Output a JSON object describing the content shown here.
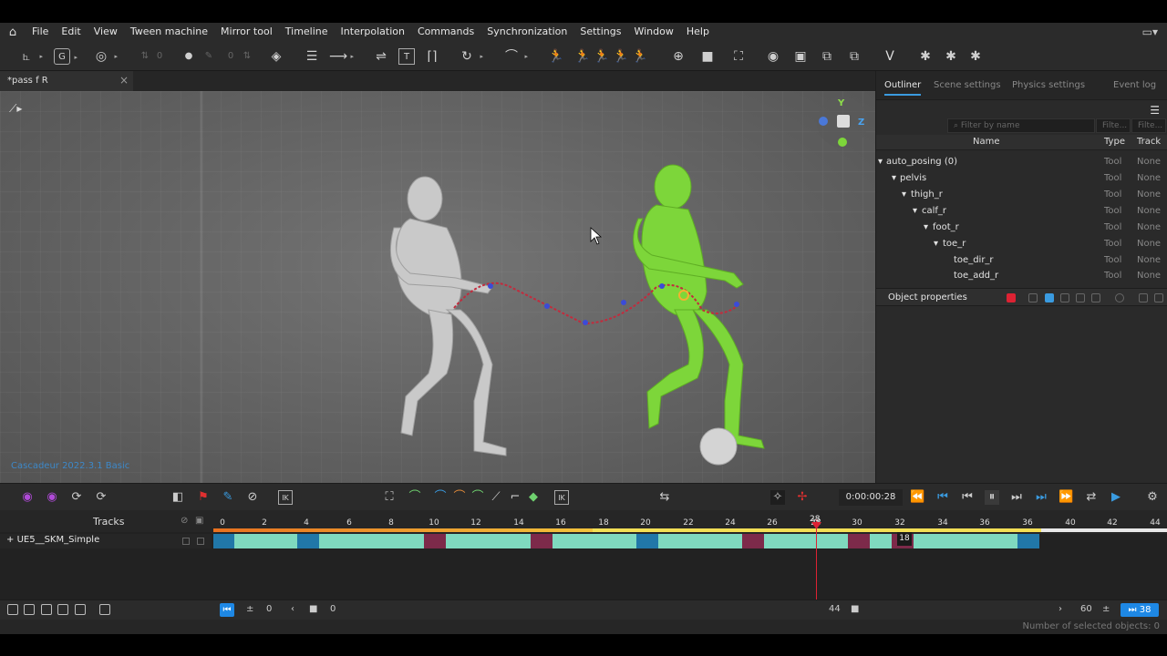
{
  "menu": {
    "home_icon": "home-icon",
    "items": [
      "File",
      "Edit",
      "View",
      "Tween machine",
      "Mirror tool",
      "Timeline",
      "Interpolation",
      "Commands",
      "Synchronization",
      "Settings",
      "Window",
      "Help"
    ]
  },
  "toolbar": {
    "field_a": "0",
    "field_b": "0"
  },
  "document_tab": {
    "title": "*pass f R"
  },
  "viewport": {
    "watermark": "Cascadeur 2022.3.1 Basic",
    "gizmo": {
      "y": "Y",
      "z": "Z"
    }
  },
  "right_panel": {
    "tabs": [
      "Outliner",
      "Scene settings",
      "Physics settings",
      "Event log"
    ],
    "filter_name_placeholder": "Filter by name",
    "filter_placeholder": "Filte...",
    "columns": {
      "name": "Name",
      "type": "Type",
      "track": "Track"
    },
    "rows": [
      {
        "name": "auto_posing (0)",
        "type": "Tool",
        "track": "None",
        "arrow": "▾"
      },
      {
        "name": "pelvis",
        "type": "Tool",
        "track": "None",
        "arrow": "▾"
      },
      {
        "name": "thigh_r",
        "type": "Tool",
        "track": "None",
        "arrow": "▾"
      },
      {
        "name": "calf_r",
        "type": "Tool",
        "track": "None",
        "arrow": "▾"
      },
      {
        "name": "foot_r",
        "type": "Tool",
        "track": "None",
        "arrow": "▾"
      },
      {
        "name": "toe_r",
        "type": "Tool",
        "track": "None",
        "arrow": "▾"
      },
      {
        "name": "toe_dir_r",
        "type": "Tool",
        "track": "None",
        "arrow": ""
      },
      {
        "name": "toe_add_r",
        "type": "Tool",
        "track": "None",
        "arrow": ""
      }
    ],
    "object_properties": "Object properties"
  },
  "controls": {
    "timecode": "0:00:00:28"
  },
  "timeline": {
    "tracks_label": "Tracks",
    "track_name": "UE5__SKM_Simple",
    "ruler_ticks": [
      "0",
      "2",
      "4",
      "6",
      "8",
      "10",
      "12",
      "14",
      "16",
      "18",
      "20",
      "22",
      "24",
      "26",
      "28",
      "30",
      "32",
      "34",
      "36",
      "36",
      "40",
      "42",
      "44"
    ],
    "current_frame": "28",
    "interval_label": "18",
    "clip_colors": {
      "teal": "#7fd9bf",
      "blue": "#2177a8",
      "maroon": "#7d2a4a"
    }
  },
  "bottom": {
    "start_frame": "0",
    "frame_value": "0",
    "end_marker": "44",
    "fps": "60",
    "last_frame": "38"
  },
  "status": {
    "selected_objects": "Number of selected objects: 0"
  }
}
